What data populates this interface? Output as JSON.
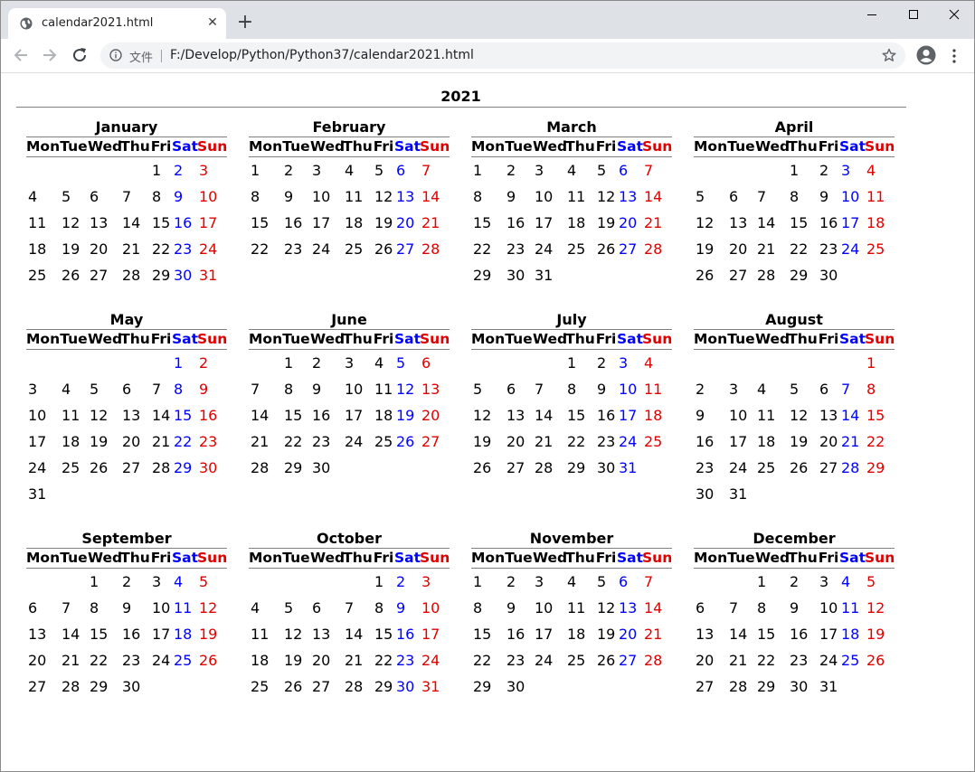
{
  "browser": {
    "tab_title": "calendar2021.html",
    "new_tab_label": "+",
    "close_tab_label": "✕",
    "secure_label": "文件",
    "url": "F:/Develop/Python/Python37/calendar2021.html"
  },
  "calendar": {
    "year": "2021",
    "weekdays": [
      "Mon",
      "Tue",
      "Wed",
      "Thu",
      "Fri",
      "Sat",
      "Sun"
    ],
    "colors": {
      "saturday": "#0000ff",
      "sunday": "#e00000",
      "text": "#000000"
    },
    "months": [
      {
        "name": "January",
        "weeks": [
          [
            "",
            "",
            "",
            "",
            "1",
            "2",
            "3"
          ],
          [
            "4",
            "5",
            "6",
            "7",
            "8",
            "9",
            "10"
          ],
          [
            "11",
            "12",
            "13",
            "14",
            "15",
            "16",
            "17"
          ],
          [
            "18",
            "19",
            "20",
            "21",
            "22",
            "23",
            "24"
          ],
          [
            "25",
            "26",
            "27",
            "28",
            "29",
            "30",
            "31"
          ]
        ]
      },
      {
        "name": "February",
        "weeks": [
          [
            "1",
            "2",
            "3",
            "4",
            "5",
            "6",
            "7"
          ],
          [
            "8",
            "9",
            "10",
            "11",
            "12",
            "13",
            "14"
          ],
          [
            "15",
            "16",
            "17",
            "18",
            "19",
            "20",
            "21"
          ],
          [
            "22",
            "23",
            "24",
            "25",
            "26",
            "27",
            "28"
          ]
        ]
      },
      {
        "name": "March",
        "weeks": [
          [
            "1",
            "2",
            "3",
            "4",
            "5",
            "6",
            "7"
          ],
          [
            "8",
            "9",
            "10",
            "11",
            "12",
            "13",
            "14"
          ],
          [
            "15",
            "16",
            "17",
            "18",
            "19",
            "20",
            "21"
          ],
          [
            "22",
            "23",
            "24",
            "25",
            "26",
            "27",
            "28"
          ],
          [
            "29",
            "30",
            "31",
            "",
            "",
            "",
            ""
          ]
        ]
      },
      {
        "name": "April",
        "weeks": [
          [
            "",
            "",
            "",
            "1",
            "2",
            "3",
            "4"
          ],
          [
            "5",
            "6",
            "7",
            "8",
            "9",
            "10",
            "11"
          ],
          [
            "12",
            "13",
            "14",
            "15",
            "16",
            "17",
            "18"
          ],
          [
            "19",
            "20",
            "21",
            "22",
            "23",
            "24",
            "25"
          ],
          [
            "26",
            "27",
            "28",
            "29",
            "30",
            "",
            ""
          ]
        ]
      },
      {
        "name": "May",
        "weeks": [
          [
            "",
            "",
            "",
            "",
            "",
            "1",
            "2"
          ],
          [
            "3",
            "4",
            "5",
            "6",
            "7",
            "8",
            "9"
          ],
          [
            "10",
            "11",
            "12",
            "13",
            "14",
            "15",
            "16"
          ],
          [
            "17",
            "18",
            "19",
            "20",
            "21",
            "22",
            "23"
          ],
          [
            "24",
            "25",
            "26",
            "27",
            "28",
            "29",
            "30"
          ],
          [
            "31",
            "",
            "",
            "",
            "",
            "",
            ""
          ]
        ]
      },
      {
        "name": "June",
        "weeks": [
          [
            "",
            "1",
            "2",
            "3",
            "4",
            "5",
            "6"
          ],
          [
            "7",
            "8",
            "9",
            "10",
            "11",
            "12",
            "13"
          ],
          [
            "14",
            "15",
            "16",
            "17",
            "18",
            "19",
            "20"
          ],
          [
            "21",
            "22",
            "23",
            "24",
            "25",
            "26",
            "27"
          ],
          [
            "28",
            "29",
            "30",
            "",
            "",
            "",
            ""
          ]
        ]
      },
      {
        "name": "July",
        "weeks": [
          [
            "",
            "",
            "",
            "1",
            "2",
            "3",
            "4"
          ],
          [
            "5",
            "6",
            "7",
            "8",
            "9",
            "10",
            "11"
          ],
          [
            "12",
            "13",
            "14",
            "15",
            "16",
            "17",
            "18"
          ],
          [
            "19",
            "20",
            "21",
            "22",
            "23",
            "24",
            "25"
          ],
          [
            "26",
            "27",
            "28",
            "29",
            "30",
            "31",
            ""
          ]
        ]
      },
      {
        "name": "August",
        "weeks": [
          [
            "",
            "",
            "",
            "",
            "",
            "",
            "1"
          ],
          [
            "2",
            "3",
            "4",
            "5",
            "6",
            "7",
            "8"
          ],
          [
            "9",
            "10",
            "11",
            "12",
            "13",
            "14",
            "15"
          ],
          [
            "16",
            "17",
            "18",
            "19",
            "20",
            "21",
            "22"
          ],
          [
            "23",
            "24",
            "25",
            "26",
            "27",
            "28",
            "29"
          ],
          [
            "30",
            "31",
            "",
            "",
            "",
            "",
            ""
          ]
        ]
      },
      {
        "name": "September",
        "weeks": [
          [
            "",
            "",
            "1",
            "2",
            "3",
            "4",
            "5"
          ],
          [
            "6",
            "7",
            "8",
            "9",
            "10",
            "11",
            "12"
          ],
          [
            "13",
            "14",
            "15",
            "16",
            "17",
            "18",
            "19"
          ],
          [
            "20",
            "21",
            "22",
            "23",
            "24",
            "25",
            "26"
          ],
          [
            "27",
            "28",
            "29",
            "30",
            "",
            "",
            ""
          ]
        ]
      },
      {
        "name": "October",
        "weeks": [
          [
            "",
            "",
            "",
            "",
            "1",
            "2",
            "3"
          ],
          [
            "4",
            "5",
            "6",
            "7",
            "8",
            "9",
            "10"
          ],
          [
            "11",
            "12",
            "13",
            "14",
            "15",
            "16",
            "17"
          ],
          [
            "18",
            "19",
            "20",
            "21",
            "22",
            "23",
            "24"
          ],
          [
            "25",
            "26",
            "27",
            "28",
            "29",
            "30",
            "31"
          ]
        ]
      },
      {
        "name": "November",
        "weeks": [
          [
            "1",
            "2",
            "3",
            "4",
            "5",
            "6",
            "7"
          ],
          [
            "8",
            "9",
            "10",
            "11",
            "12",
            "13",
            "14"
          ],
          [
            "15",
            "16",
            "17",
            "18",
            "19",
            "20",
            "21"
          ],
          [
            "22",
            "23",
            "24",
            "25",
            "26",
            "27",
            "28"
          ],
          [
            "29",
            "30",
            "",
            "",
            "",
            "",
            ""
          ]
        ]
      },
      {
        "name": "December",
        "weeks": [
          [
            "",
            "",
            "1",
            "2",
            "3",
            "4",
            "5"
          ],
          [
            "6",
            "7",
            "8",
            "9",
            "10",
            "11",
            "12"
          ],
          [
            "13",
            "14",
            "15",
            "16",
            "17",
            "18",
            "19"
          ],
          [
            "20",
            "21",
            "22",
            "23",
            "24",
            "25",
            "26"
          ],
          [
            "27",
            "28",
            "29",
            "30",
            "31",
            "",
            ""
          ]
        ]
      }
    ]
  }
}
